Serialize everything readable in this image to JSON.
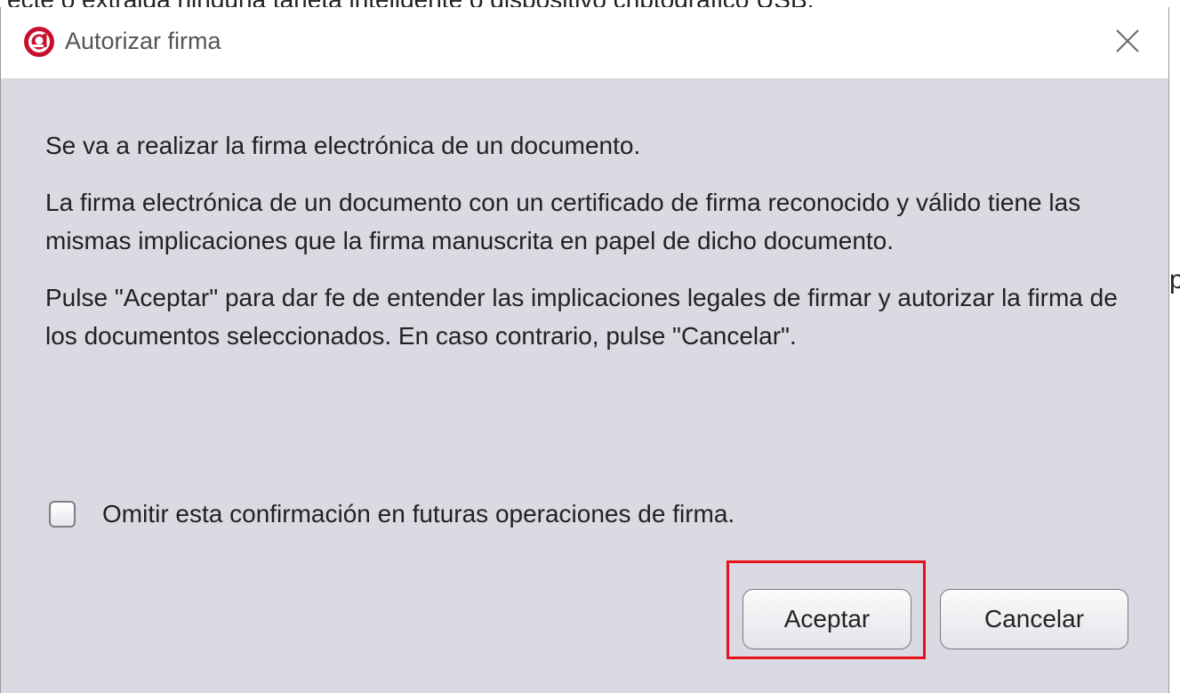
{
  "background": {
    "partial_text": "ecte o extraida ninguna tarjeta inteligente o dispositivo criptografico USB.",
    "right_edge_char": "p"
  },
  "dialog": {
    "title": "Autorizar firma",
    "app_icon": "autofirma-logo-icon",
    "close_icon": "close-icon",
    "paragraphs": [
      "Se va a realizar la firma electrónica de un documento.",
      "La firma electrónica de un documento con un certificado de firma reconocido y válido tiene las mismas implicaciones que la firma manuscrita en papel de dicho documento.",
      "Pulse \"Aceptar\" para dar fe de entender las implicaciones legales de firmar y autorizar la firma de los documentos seleccionados. En caso contrario, pulse \"Cancelar\"."
    ],
    "checkbox": {
      "label": "Omitir esta confirmación en futuras operaciones de firma.",
      "checked": false
    },
    "buttons": {
      "accept_label": "Aceptar",
      "cancel_label": "Cancelar"
    }
  },
  "colors": {
    "dialog_bg": "#d9dae2",
    "highlight": "#e8101a",
    "icon_red": "#c8102e"
  }
}
